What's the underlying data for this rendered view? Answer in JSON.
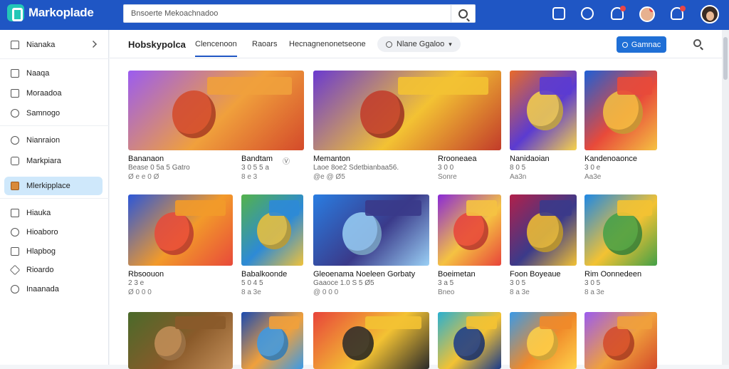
{
  "app": {
    "title": "Markoplade"
  },
  "search": {
    "value": "Bnsoerte Mekoachnadoo"
  },
  "sidebar": {
    "items": [
      {
        "label": "Nianaka"
      },
      {
        "label": "Naaqa"
      },
      {
        "label": "Moraadoa"
      },
      {
        "label": "Samnogo"
      },
      {
        "label": "Nianraion"
      },
      {
        "label": "Markpiara"
      },
      {
        "label": "Mlerkipplace"
      },
      {
        "label": "Hiauka"
      },
      {
        "label": "Hioaboro"
      },
      {
        "label": "Hlapbog"
      },
      {
        "label": "Rioardo"
      },
      {
        "label": "Inaanada"
      }
    ]
  },
  "tabs": {
    "title": "Hobskypolca",
    "items": [
      {
        "label": "Clencenoon"
      },
      {
        "label": "Raoars"
      },
      {
        "label": "Hecnagnenonetseone"
      }
    ],
    "filter_label": "Nlane Ggaloo",
    "primary_label": "Gamnac"
  },
  "cards": [
    {
      "title": "Bananaon",
      "sub": "Bease 0 5a 5 Gatro",
      "rating": "Ø e e 0 Ø"
    },
    {
      "title": "Bandtam",
      "sub": "3 0 5 5 a",
      "rating": "8 e 3",
      "extra": "Ⓥ"
    },
    {
      "title": "Memanton",
      "sub": "Laoe 8oe2 Sdetbianbaa56.",
      "rating": "@e @ Ø5"
    },
    {
      "title": "Rrooneaea",
      "sub": "3 0 0",
      "rating": "Sonre"
    },
    {
      "title": "Nanidaoian",
      "sub": "8 0 5",
      "rating": "Aa3n"
    },
    {
      "title": "Kandenoaonce",
      "sub": "3 0 e",
      "rating": "Aa3e"
    },
    {
      "title": "Rbsoouon",
      "sub": "2 3 e",
      "rating": "Ø 0 0 0"
    },
    {
      "title": "Babalkoonde",
      "sub": "5 0 4 5",
      "rating": "8 a 3e"
    },
    {
      "title": "Gleoenama Noeleen Gorbaty",
      "sub": "Gaaoce 1.0 S 5 Ø5",
      "rating": "@ 0 0 0"
    },
    {
      "title": "Boeimetan",
      "sub": "3 a 5",
      "rating": "Bneo"
    },
    {
      "title": "Foon Boyeaue",
      "sub": "3 0 5",
      "rating": "8 a 3e"
    },
    {
      "title": "Rim Oonnedeen",
      "sub": "3 0 5",
      "rating": "8 a 3e"
    },
    {
      "title": "",
      "sub": "",
      "rating": ""
    },
    {
      "title": "",
      "sub": "",
      "rating": ""
    },
    {
      "title": "",
      "sub": "",
      "rating": ""
    },
    {
      "title": "",
      "sub": "",
      "rating": ""
    },
    {
      "title": "",
      "sub": "",
      "rating": ""
    },
    {
      "title": "",
      "sub": "",
      "rating": ""
    }
  ],
  "colors": {
    "header": "#1f56c4",
    "accent": "#1f6fd6",
    "active_bg": "#cfe8fb"
  }
}
